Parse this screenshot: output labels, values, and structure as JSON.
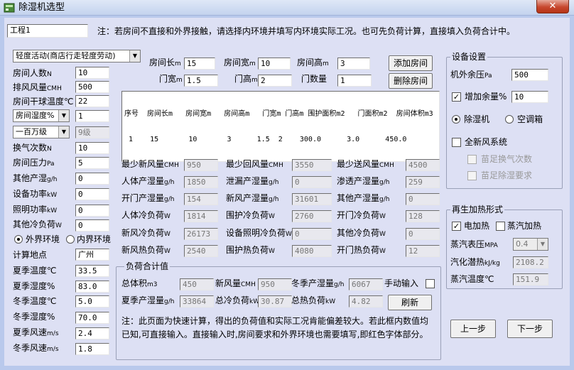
{
  "window": {
    "title": "除湿机选型",
    "close": "✕"
  },
  "header": {
    "project_value": "工程1",
    "note": "注：若房间不直接和外界接触，请选择内环境并填写内环境实际工况。也可先负荷计算，直接填入负荷合计中。"
  },
  "left": {
    "activity": "轻度活动(商店行走轻度劳动)",
    "people_label": "房间人数",
    "people_unit": "N",
    "people": "10",
    "exhaust_label": "排风风量",
    "exhaust_unit": "CMH",
    "exhaust": "500",
    "drybulb_label": "房间干球温度",
    "drybulb_unit": "℃",
    "drybulb": "22",
    "humidity_type": "房间湿度%",
    "humidity": "1",
    "clean_class": "一百万级",
    "clean_level": "9级",
    "ach_label": "换气次数",
    "ach_unit": "N",
    "ach": "10",
    "pressure_label": "房间压力",
    "pressure_unit": "Pa",
    "pressure": "5",
    "other_moist_label": "其他产湿",
    "other_moist_unit": "g/h",
    "other_moist": "0",
    "equip_label": "设备功率",
    "equip_unit": "kW",
    "equip": "0",
    "light_label": "照明功率",
    "light_unit": "kW",
    "light": "0",
    "other_cool_label": "其他冷负荷",
    "other_cool_unit": "W",
    "other_cool": "0",
    "env_outer": "外界环境",
    "env_inner": "内界环境",
    "location_label": "计算地点",
    "location": "广州",
    "summer_temp_label": "夏季温度",
    "summer_temp_unit": "℃",
    "summer_temp": "33.5",
    "summer_hum_label": "夏季湿度",
    "summer_hum_unit": "%",
    "summer_hum": "83.0",
    "winter_temp_label": "冬季温度",
    "winter_temp_unit": "℃",
    "winter_temp": "5.0",
    "winter_hum_label": "冬季湿度",
    "winter_hum_unit": "%",
    "winter_hum": "70.0",
    "summer_wind_label": "夏季风速",
    "summer_wind_unit": "m/s",
    "summer_wind": "2.4",
    "winter_wind_label": "冬季风速",
    "winter_wind_unit": "m/s",
    "winter_wind": "1.8"
  },
  "room": {
    "length_label": "房间长",
    "length_unit": "m",
    "length": "15",
    "width_label": "房间宽",
    "width_unit": "m",
    "width": "10",
    "height_label": "房间高",
    "height_unit": "m",
    "height": "3",
    "door_w_label": "门宽",
    "door_w_unit": "m",
    "door_w": "1.5",
    "door_h_label": "门高",
    "door_h_unit": "m",
    "door_h": "2",
    "door_n_label": "门数量",
    "door_n": "1",
    "add_button": "添加房间",
    "delete_button": "删除房间"
  },
  "table": {
    "columns": [
      "序号",
      "房间长m",
      "房间宽m",
      "房间高m",
      "门宽m",
      "门高m",
      "围护面积m2",
      "门面积m2",
      "房间体积m3"
    ],
    "rows": [
      [
        "1",
        "15",
        "10",
        "3",
        "1.5",
        "2",
        "300.0",
        "3.0",
        "450.0"
      ]
    ]
  },
  "calc": {
    "min_fresh_label": "最少新风量",
    "min_fresh_unit": "CMH",
    "min_fresh": "950",
    "min_return_label": "最少回风量",
    "min_return_unit": "CMH",
    "min_return": "3550",
    "min_supply_label": "最少送风量",
    "min_supply_unit": "CMH",
    "min_supply": "4500",
    "body_moist_label": "人体产湿量",
    "body_moist_unit": "g/h",
    "body_moist": "1850",
    "leak_moist_label": "泄漏产湿量",
    "leak_moist_unit": "g/h",
    "leak_moist": "0",
    "seep_moist_label": "渗透产湿量",
    "seep_moist_unit": "g/h",
    "seep_moist": "259",
    "door_moist_label": "开门产湿量",
    "door_moist_unit": "g/h",
    "door_moist": "154",
    "fresh_moist_label": "新风产湿量",
    "fresh_moist_unit": "g/h",
    "fresh_moist": "31601",
    "other_moist_label": "其他产湿量",
    "other_moist_unit": "g/h",
    "other_moist": "0",
    "body_cool_label": "人体冷负荷",
    "body_cool_unit": "W",
    "body_cool": "1814",
    "wall_cool_label": "围护冷负荷",
    "wall_cool_unit": "W",
    "wall_cool": "2760",
    "door_cool_label": "开门冷负荷",
    "door_cool_unit": "W",
    "door_cool": "128",
    "fresh_cool_label": "新风冷负荷",
    "fresh_cool_unit": "W",
    "fresh_cool": "26173",
    "equip_cool_label": "设备照明冷负荷",
    "equip_cool_unit": "W",
    "equip_cool": "0",
    "other_cool_label": "其他冷负荷",
    "other_cool_unit": "W",
    "other_cool": "0",
    "fresh_heat_label": "新风热负荷",
    "fresh_heat_unit": "W",
    "fresh_heat": "2540",
    "wall_heat_label": "围护热负荷",
    "wall_heat_unit": "W",
    "wall_heat": "4080",
    "door_heat_label": "开门热负荷",
    "door_heat_unit": "W",
    "door_heat": "12"
  },
  "totals": {
    "title": "负荷合计值",
    "volume_label": "总体积",
    "volume_unit": "m3",
    "volume": "450",
    "fresh_label": "新风量",
    "fresh_unit": "CMH",
    "fresh": "950",
    "winter_moist_label": "冬季产湿量",
    "winter_moist_unit": "g/h",
    "winter_moist": "6067",
    "manual_label": "手动输入",
    "summer_moist_label": "夏季产湿量",
    "summer_moist_unit": "g/h",
    "summer_moist": "33864",
    "total_cool_label": "总冷负荷",
    "total_cool_unit": "kW",
    "total_cool": "30.87",
    "total_heat_label": "总热负荷",
    "total_heat_unit": "kW",
    "total_heat": "4.82",
    "refresh_button": "刷新",
    "note": "注：此页面为快速计算，得出的负荷值和实际工况肯能偏差较大。若此框内数值均已知,可直接输入。直接输入时,房间要求和外界环境也需要填写,即红色字体部分。"
  },
  "equipment": {
    "title": "设备设置",
    "ext_pressure_label": "机外余压",
    "ext_pressure_unit": "Pa",
    "ext_pressure": "500",
    "margin_label": "增加余量%",
    "margin": "10",
    "dehumidifier": "除湿机",
    "ac_box": "空调箱",
    "fresh_system": "全新风系统",
    "meet_ach": "苗足换气次数",
    "meet_dehum": "苗足除湿要求"
  },
  "reheat": {
    "title": "再生加热形式",
    "electric": "电加热",
    "steam": "蒸汽加热",
    "steam_pressure_label": "蒸汽表压",
    "steam_pressure_unit": "MPA",
    "steam_pressure": "0.4",
    "latent_label": "汽化潜热",
    "latent_unit": "kJ/kg",
    "latent": "2108.2",
    "steam_temp_label": "蒸汽温度",
    "steam_temp_unit": "℃",
    "steam_temp": "151.9"
  },
  "nav": {
    "prev": "上一步",
    "next": "下一步"
  }
}
